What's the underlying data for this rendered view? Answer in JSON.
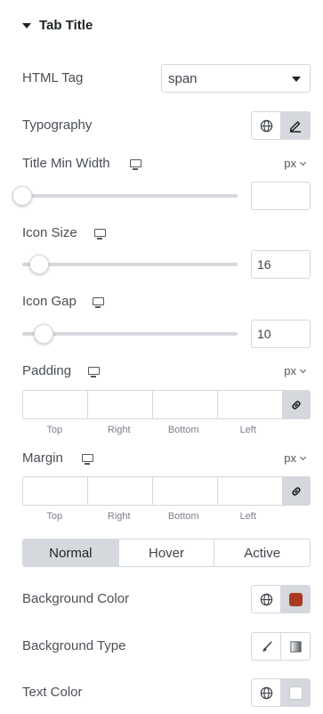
{
  "section": {
    "title": "Tab Title"
  },
  "html_tag": {
    "label": "HTML Tag",
    "value": "span"
  },
  "typography": {
    "label": "Typography"
  },
  "title_min_width": {
    "label": "Title Min Width",
    "unit": "px",
    "value": "",
    "slider_fraction": 0
  },
  "icon_size": {
    "label": "Icon Size",
    "value": "16",
    "slider_fraction": 0.08
  },
  "icon_gap": {
    "label": "Icon Gap",
    "value": "10",
    "slider_fraction": 0.1
  },
  "padding": {
    "label": "Padding",
    "unit": "px",
    "sides": [
      "Top",
      "Right",
      "Bottom",
      "Left"
    ]
  },
  "margin": {
    "label": "Margin",
    "unit": "px",
    "sides": [
      "Top",
      "Right",
      "Bottom",
      "Left"
    ]
  },
  "state_tabs": {
    "items": [
      "Normal",
      "Hover",
      "Active"
    ],
    "active": "Normal"
  },
  "background_color": {
    "label": "Background Color",
    "color": "#a83a22"
  },
  "background_type": {
    "label": "Background Type"
  },
  "text_color": {
    "label": "Text Color",
    "color": "#ffffff"
  },
  "icons": {
    "globe": "globe-icon",
    "edit": "pencil-icon",
    "device": "desktop-icon",
    "link": "link-icon",
    "brush": "brush-icon",
    "gradient": "gradient-icon"
  }
}
